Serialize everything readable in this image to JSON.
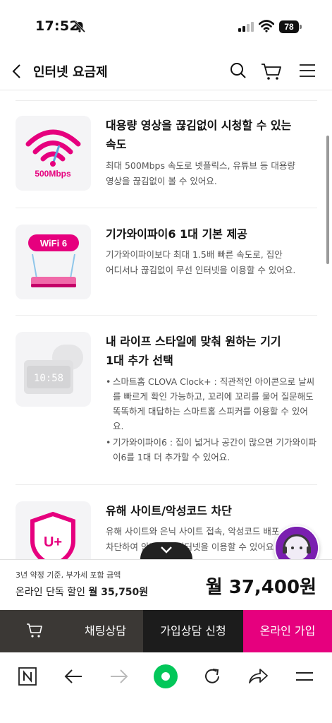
{
  "status_bar": {
    "time": "17:52",
    "battery": "78"
  },
  "header": {
    "title": "인터넷 요금제"
  },
  "features": [
    {
      "image_label": "500Mbps",
      "title_line1": "대용량 영상을 끊김없이 시청할 수 있는",
      "title_line2": "속도",
      "desc_line1": "최대 500Mbps 속도로 넷플릭스, 유튜브 등 대용량",
      "desc_line2": "영상을 끊김없이 볼 수 있어요."
    },
    {
      "image_label": "WiFi 6",
      "title_line1": "기가와이파이6 1대 기본 제공",
      "desc_line1": "기가와이파이보다 최대 1.5배 빠른 속도로, 집안",
      "desc_line2": "어디서나 끊김없이 무선 인터넷을 이용할 수 있어요."
    },
    {
      "image_label": "10:58",
      "title_line1": "내 라이프 스타일에 맞춰 원하는 기기",
      "title_line2": "1대 추가 선택",
      "bullets": [
        "스마트홈 CLOVA Clock+ : 직관적인 아이콘으로 날씨를 빠르게 확인 가능하고, 꼬리에 꼬리를 물어 질문해도 똑똑하게 대답하는 스마트홈 스피커를 이용할 수 있어요.",
        "기가와이파이6 : 집이 넓거나 공간이 많으면 기가와이파이6를 1대 더 추가할 수 있어요."
      ]
    },
    {
      "image_label": "U+",
      "title_line1": "유해 사이트/악성코드 차단",
      "desc_line1": "유해 사이트와 은닉 사이트 접속, 악성코드 배포 ...",
      "desc_line2": "차단하여 안전하게 인터넷을 이용할 수 있어요."
    }
  ],
  "price": {
    "note": "3년 약정 기준, 부가세 포함 금액",
    "discount_label": "온라인 단독 할인",
    "discount_value": "월 35,750원",
    "total": "월 37,400원"
  },
  "actions": {
    "chat": "채팅상담",
    "apply": "가입상담 신청",
    "online": "온라인 가입"
  },
  "colors": {
    "brand": "#e6007e",
    "dark": "#3b3835",
    "green": "#03c75a"
  },
  "icons": [
    "bell-off-icon",
    "signal-icon",
    "wifi-icon",
    "battery-icon",
    "back-icon",
    "search-icon",
    "cart-icon",
    "menu-icon",
    "chevron-down-icon",
    "naver-icon",
    "arrow-left-icon",
    "arrow-right-icon",
    "home-dot-icon",
    "refresh-icon",
    "share-icon",
    "hamburger-icon"
  ]
}
